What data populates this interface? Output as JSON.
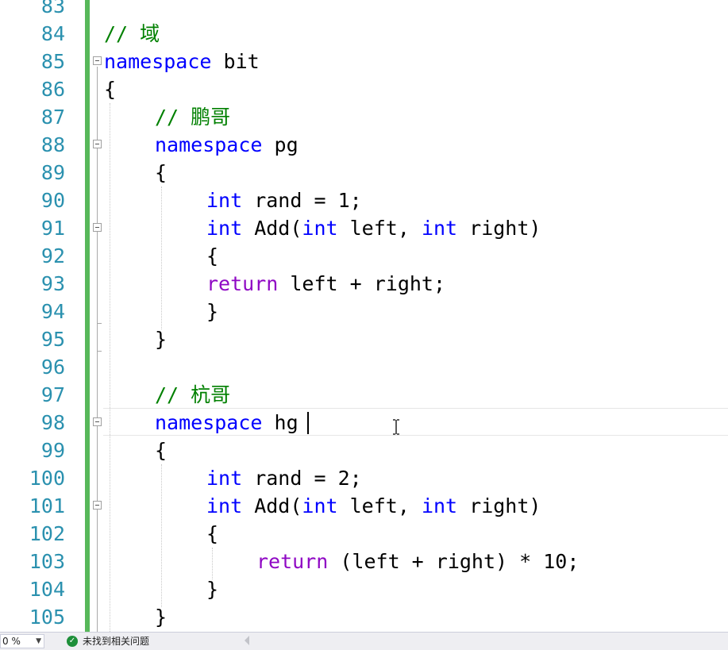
{
  "editor": {
    "line_numbers": [
      "83",
      "84",
      "85",
      "86",
      "87",
      "88",
      "89",
      "90",
      "91",
      "92",
      "93",
      "94",
      "95",
      "96",
      "97",
      "98",
      "99",
      "100",
      "101",
      "102",
      "103",
      "104",
      "105"
    ],
    "tokens": {
      "ns_kw": "namespace",
      "int_kw": "int",
      "return_kw": "return",
      "comment_slashes": "// ",
      "comment_domain": "域",
      "comment_pengge": "鹏哥",
      "comment_hangge": "杭哥",
      "ns_bit": " bit",
      "ns_pg": " pg",
      "ns_hg": " hg",
      "open_brace": "{",
      "close_brace": "}",
      "rand_assign_1": " rand = 1;",
      "rand_assign_2": " rand = 2;",
      "add_prefix": " Add(",
      "param_left": " left, ",
      "param_right": " right)",
      "return_expr_1": " left + right;",
      "return_expr_2": " (left + right) * 10;"
    }
  },
  "statusbar": {
    "zoom_value": "0 %",
    "issues_text": "未找到相关问题"
  },
  "colors": {
    "keyword": "#0000ff",
    "control_keyword": "#8f08c4",
    "comment": "#008000",
    "line_number": "#2b91af",
    "change_bar": "#57b85a"
  }
}
